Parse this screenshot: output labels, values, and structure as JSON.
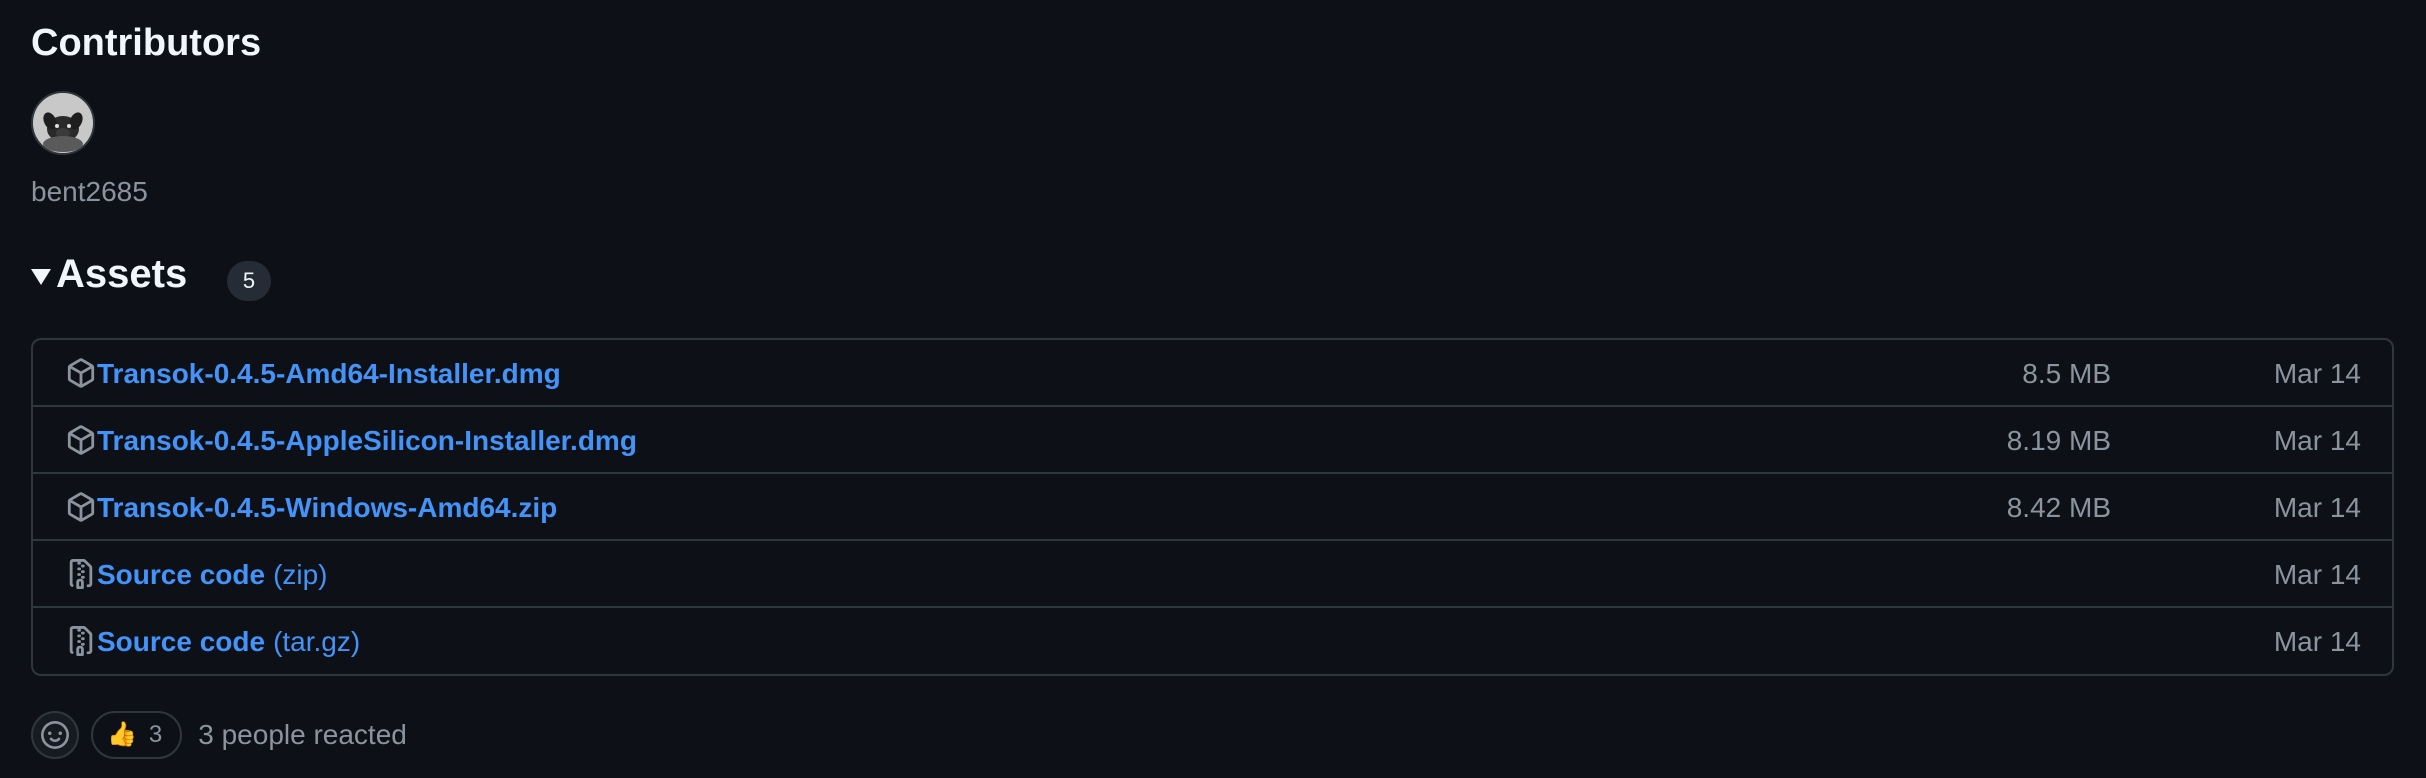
{
  "contributors": {
    "title": "Contributors",
    "items": [
      {
        "name": "bent2685",
        "avatar_icon": "dog-avatar"
      }
    ]
  },
  "assets": {
    "title": "Assets",
    "count": "5",
    "rows": [
      {
        "icon": "package-icon",
        "name": "Transok-0.4.5-Amd64-Installer.dmg",
        "suffix": "",
        "size": "8.5 MB",
        "date": "Mar 14"
      },
      {
        "icon": "package-icon",
        "name": "Transok-0.4.5-AppleSilicon-Installer.dmg",
        "suffix": "",
        "size": "8.19 MB",
        "date": "Mar 14"
      },
      {
        "icon": "package-icon",
        "name": "Transok-0.4.5-Windows-Amd64.zip",
        "suffix": "",
        "size": "8.42 MB",
        "date": "Mar 14"
      },
      {
        "icon": "file-zip-icon",
        "name": "Source code",
        "suffix": "(zip)",
        "size": "",
        "date": "Mar 14"
      },
      {
        "icon": "file-zip-icon",
        "name": "Source code",
        "suffix": "(tar.gz)",
        "size": "",
        "date": "Mar 14"
      }
    ]
  },
  "reactions": {
    "emoji_icon": "smiley-icon",
    "thumbs_up": "👍",
    "thumbs_up_count": "3",
    "summary": "3 people reacted"
  }
}
